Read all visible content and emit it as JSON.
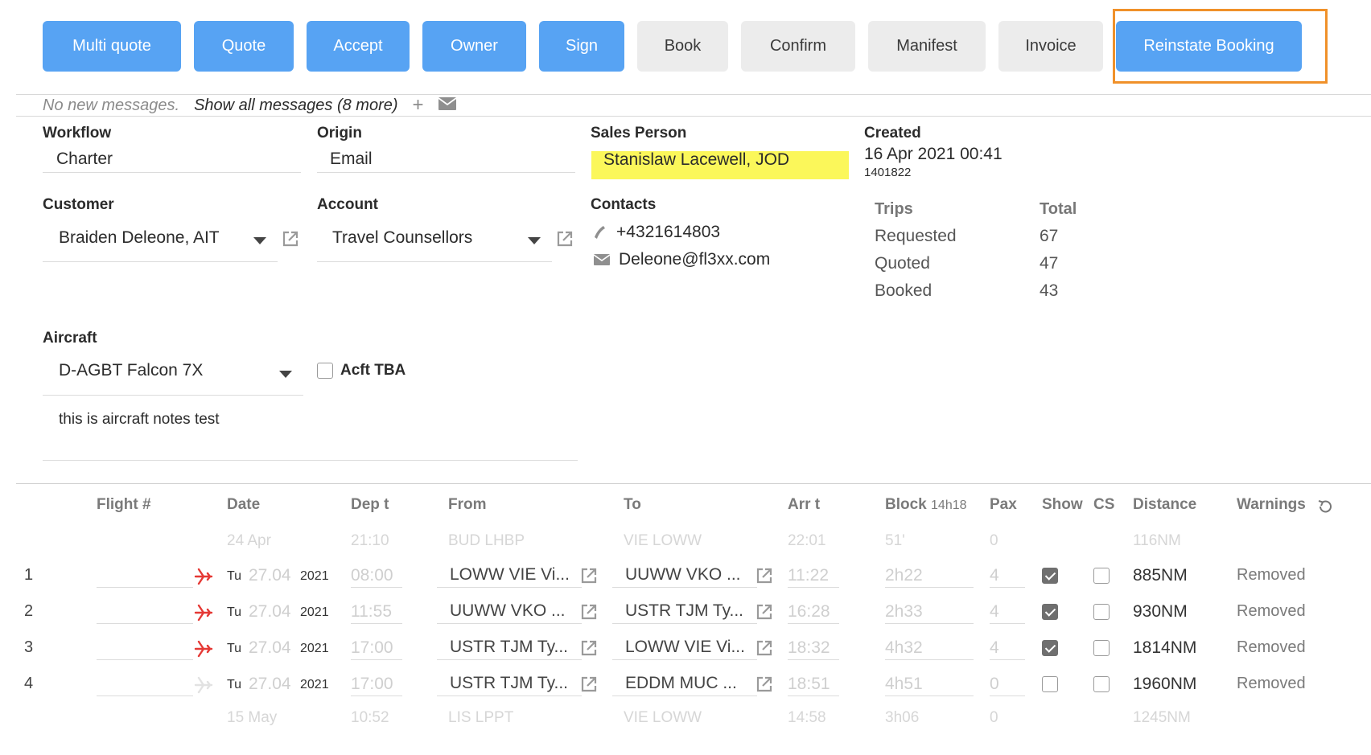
{
  "toolbar": {
    "buttons": [
      {
        "label": "Multi quote"
      },
      {
        "label": "Quote"
      },
      {
        "label": "Accept"
      },
      {
        "label": "Owner"
      },
      {
        "label": "Sign"
      },
      {
        "label": "Book"
      },
      {
        "label": "Confirm"
      },
      {
        "label": "Manifest"
      },
      {
        "label": "Invoice"
      },
      {
        "label": "Reinstate Booking"
      }
    ],
    "primary_color": "#57a3f3",
    "secondary_color": "#ececec",
    "highlight_color": "#f0912a"
  },
  "messages": {
    "no_new": "No new messages.",
    "show_all": "Show all messages (8 more)",
    "add": "+",
    "icon": "envelope-icon"
  },
  "form": {
    "workflow": {
      "label": "Workflow",
      "value": "Charter"
    },
    "origin": {
      "label": "Origin",
      "value": "Email"
    },
    "sales_person": {
      "label": "Sales Person",
      "value": "Stanislaw Lacewell, JOD",
      "highlight_color": "#fbf75a"
    },
    "created": {
      "label": "Created",
      "date": "16 Apr 2021 00:41",
      "id": "1401822"
    },
    "customer": {
      "label": "Customer",
      "value": "Braiden Deleone, AIT"
    },
    "account": {
      "label": "Account",
      "value": "Travel Counsellors"
    },
    "contacts": {
      "label": "Contacts",
      "phone": "+4321614803",
      "email": "Deleone@fl3xx.com"
    },
    "trips": {
      "header": "Trips",
      "total_header": "Total",
      "rows": [
        {
          "label": "Requested",
          "value": "67"
        },
        {
          "label": "Quoted",
          "value": "47"
        },
        {
          "label": "Booked",
          "value": "43"
        }
      ]
    },
    "aircraft": {
      "label": "Aircraft",
      "value": "D-AGBT Falcon 7X",
      "notes": "this is aircraft notes test"
    },
    "acft_tba": {
      "label": "Acft TBA",
      "checked": false
    }
  },
  "table": {
    "headers": {
      "flight": "Flight #",
      "date": "Date",
      "dep": "Dep t",
      "from": "From",
      "to": "To",
      "arr": "Arr t",
      "block": "Block",
      "block_total": "14h18",
      "pax": "Pax",
      "show": "Show",
      "cs": "CS",
      "distance": "Distance",
      "warnings": "Warnings"
    },
    "prev_leg": {
      "date": "24 Apr",
      "dep": "21:10",
      "from": "BUD LHBP",
      "to": "VIE LOWW",
      "arr": "22:01",
      "block": "51'",
      "pax": "0",
      "distance": "116NM"
    },
    "rows": [
      {
        "num": "1",
        "dow": "Tu",
        "date": "27.04",
        "year": "2021",
        "dep": "08:00",
        "from": "LOWW VIE Vi...",
        "to": "UUWW VKO ...",
        "arr": "11:22",
        "block": "2h22",
        "pax": "4",
        "show": true,
        "cs": false,
        "distance": "885NM",
        "warning": "Removed",
        "active": true
      },
      {
        "num": "2",
        "dow": "Tu",
        "date": "27.04",
        "year": "2021",
        "dep": "11:55",
        "from": "UUWW VKO ...",
        "to": "USTR TJM Ty...",
        "arr": "16:28",
        "block": "2h33",
        "pax": "4",
        "show": true,
        "cs": false,
        "distance": "930NM",
        "warning": "Removed",
        "active": true
      },
      {
        "num": "3",
        "dow": "Tu",
        "date": "27.04",
        "year": "2021",
        "dep": "17:00",
        "from": "USTR TJM Ty...",
        "to": "LOWW VIE Vi...",
        "arr": "18:32",
        "block": "4h32",
        "pax": "4",
        "show": true,
        "cs": false,
        "distance": "1814NM",
        "warning": "Removed",
        "active": true
      },
      {
        "num": "4",
        "dow": "Tu",
        "date": "27.04",
        "year": "2021",
        "dep": "17:00",
        "from": "USTR TJM Ty...",
        "to": "EDDM MUC ...",
        "arr": "18:51",
        "block": "4h51",
        "pax": "0",
        "show": false,
        "cs": false,
        "distance": "1960NM",
        "warning": "Removed",
        "active": false
      }
    ],
    "next_leg": {
      "date": "15 May",
      "dep": "10:52",
      "from": "LIS LPPT",
      "to": "VIE LOWW",
      "arr": "14:58",
      "block": "3h06",
      "pax": "0",
      "distance": "1245NM"
    },
    "plane_color": "#e53935"
  }
}
